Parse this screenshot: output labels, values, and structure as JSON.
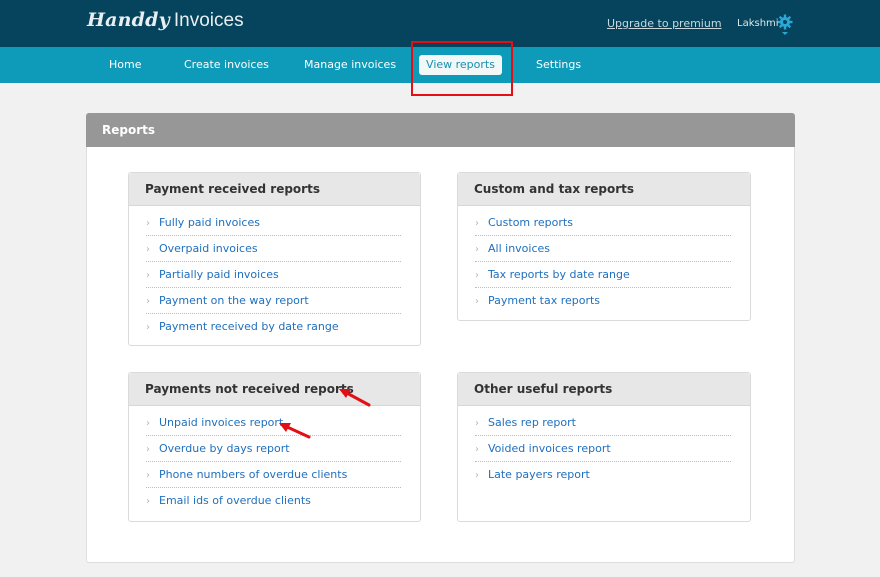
{
  "app": {
    "logo_script": "Handdy",
    "logo_word": "Invoices",
    "upgrade_link": "Upgrade to premium",
    "username": "Lakshmi"
  },
  "nav": {
    "items": [
      "Home",
      "Create invoices",
      "Manage invoices",
      "View reports",
      "Settings"
    ],
    "active": "View reports"
  },
  "panel": {
    "title": "Reports"
  },
  "cards": [
    {
      "title": "Payment received reports",
      "links": [
        "Fully paid invoices",
        "Overpaid invoices",
        "Partially paid invoices",
        "Payment on the way report",
        "Payment received by date range"
      ]
    },
    {
      "title": "Custom and tax reports",
      "links": [
        "Custom reports",
        "All invoices",
        "Tax reports by date range",
        "Payment tax reports"
      ]
    },
    {
      "title": "Payments not received reports",
      "links": [
        "Unpaid invoices report",
        "Overdue by days report",
        "Phone numbers of overdue clients",
        "Email ids of overdue clients"
      ]
    },
    {
      "title": "Other useful reports",
      "links": [
        "Sales rep report",
        "Voided invoices report",
        "Late payers report"
      ]
    }
  ],
  "colors": {
    "topbar": "#05445c",
    "navbar": "#0e9ab9",
    "link": "#1f6fbe",
    "annotation": "#e20f14"
  },
  "icons": {
    "chevron": "›",
    "settings": "gear-icon"
  }
}
